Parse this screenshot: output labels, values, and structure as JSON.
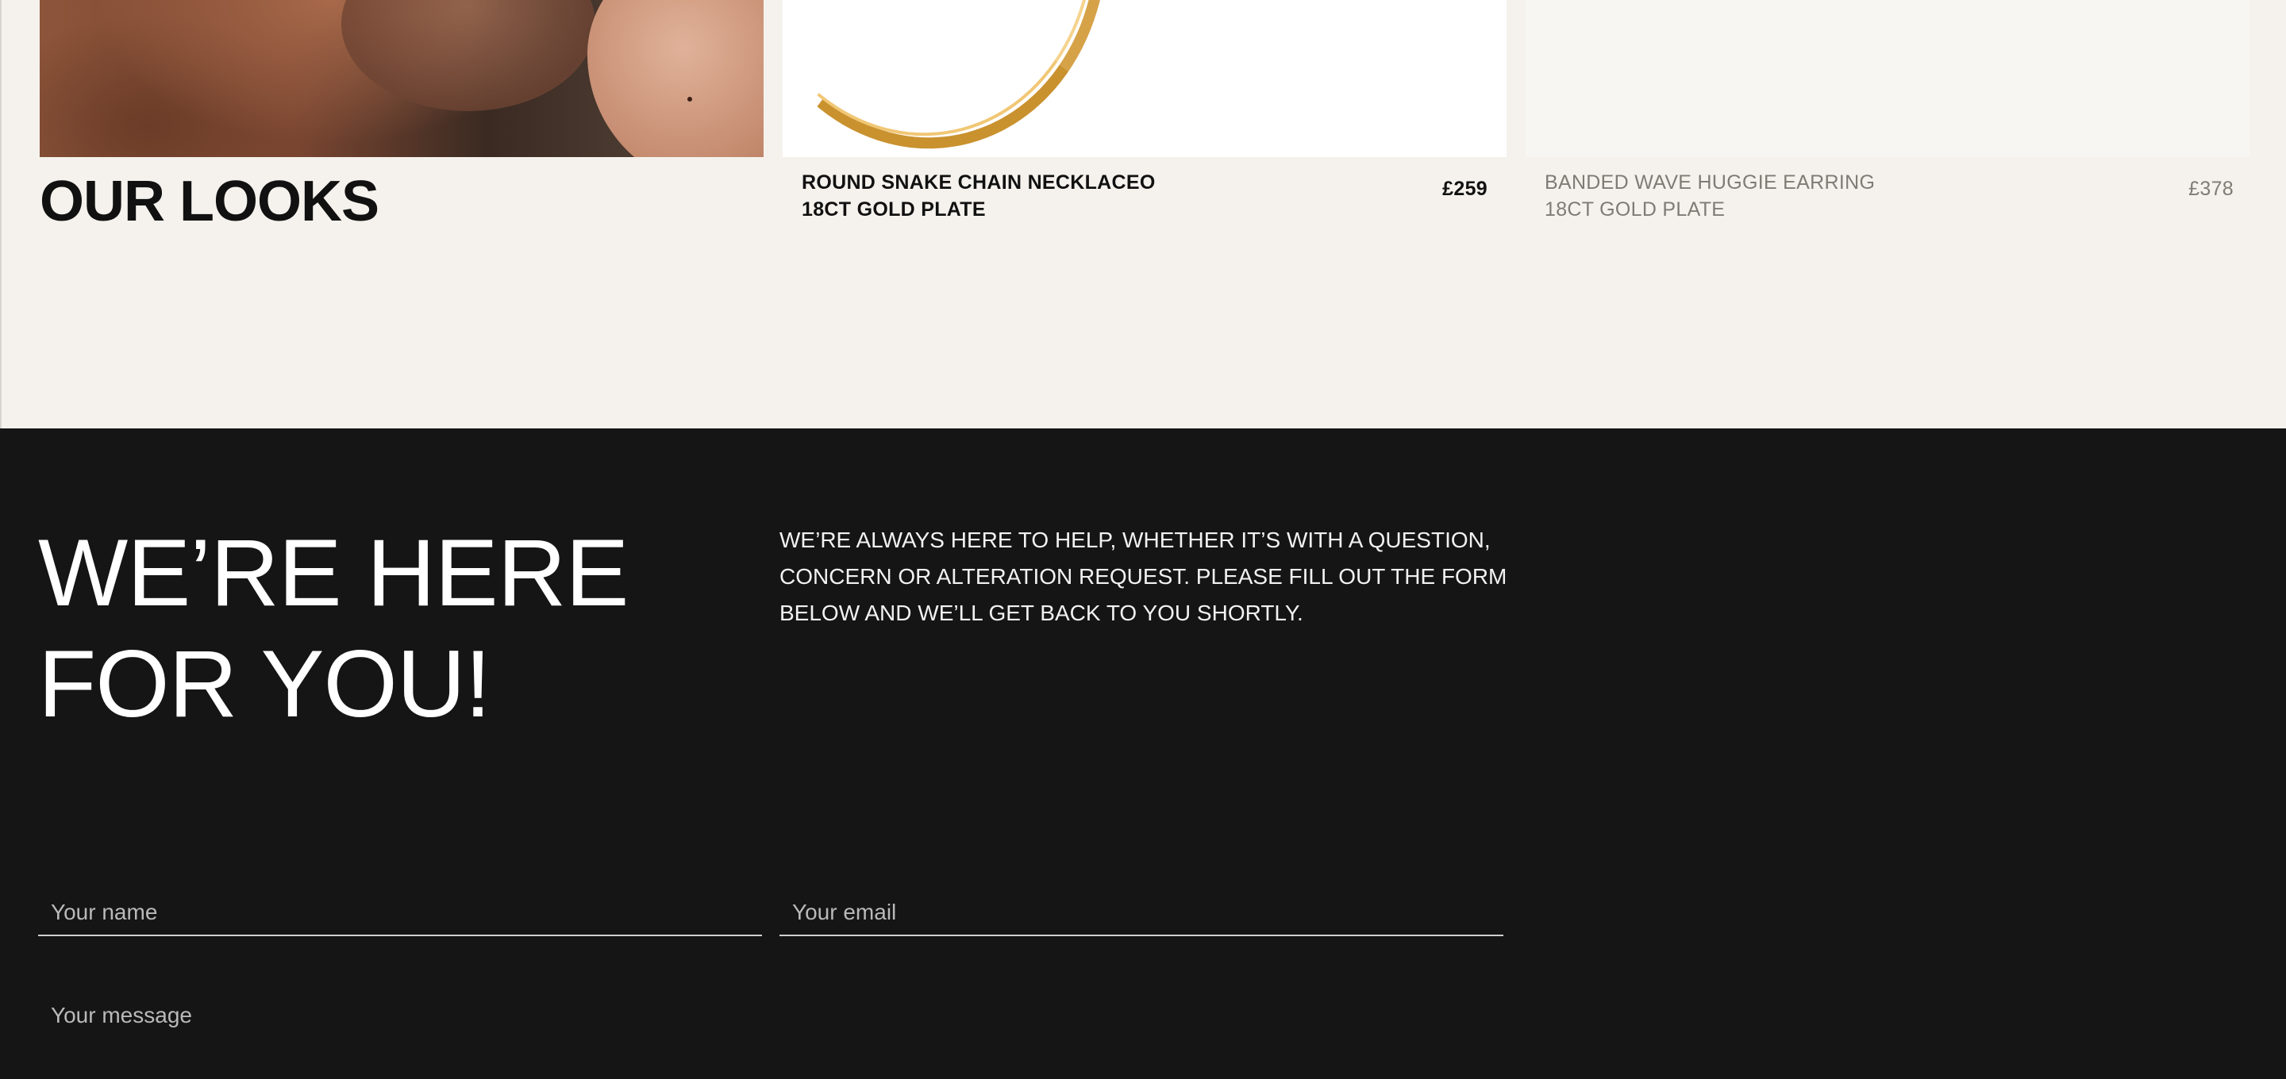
{
  "looks": {
    "title": "OUR LOOKS"
  },
  "products": [
    {
      "name_line1": "ROUND SNAKE CHAIN NECKLACEO",
      "name_line2": "18CT GOLD PLATE",
      "price": "£259"
    },
    {
      "name_line1": "BANDED WAVE HUGGIE EARRING",
      "name_line2": "18CT GOLD PLATE",
      "price": "£378"
    }
  ],
  "contact": {
    "heading": "WE’RE HERE FOR YOU!",
    "intro": "WE’RE ALWAYS HERE TO HELP, WHETHER IT’S WITH A QUESTION, CONCERN OR ALTERATION REQUEST. PLEASE FILL OUT THE FORM BELOW AND WE’LL GET BACK TO YOU SHORTLY.",
    "name_placeholder": "Your name",
    "email_placeholder": "Your email",
    "message_placeholder": "Your message"
  },
  "colors": {
    "page_background": "#f5f2ed",
    "contact_background": "#151515",
    "muted_text": "#7f7b75"
  }
}
